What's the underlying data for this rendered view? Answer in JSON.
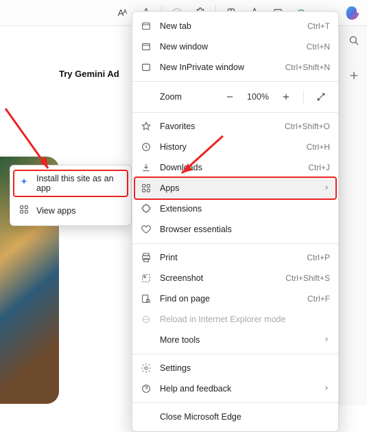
{
  "toolbar": {
    "read_aloud": "Aᴬ",
    "icons": [
      "favorites-star",
      "shield-icon",
      "extensions-icon",
      "collections-icon",
      "favorites-add-icon",
      "clip-icon",
      "performance-icon",
      "more-icon"
    ]
  },
  "page": {
    "gemini_text": "Try Gemini Ad"
  },
  "sidebar_icons": [
    "search-icon",
    "plus-icon"
  ],
  "submenu": {
    "install_label": "Install this site as an app",
    "view_label": "View apps"
  },
  "menu": {
    "new_tab": {
      "label": "New tab",
      "shortcut": "Ctrl+T"
    },
    "new_window": {
      "label": "New window",
      "shortcut": "Ctrl+N"
    },
    "new_inprivate": {
      "label": "New InPrivate window",
      "shortcut": "Ctrl+Shift+N"
    },
    "zoom": {
      "label": "Zoom",
      "value": "100%"
    },
    "favorites": {
      "label": "Favorites",
      "shortcut": "Ctrl+Shift+O"
    },
    "history": {
      "label": "History",
      "shortcut": "Ctrl+H"
    },
    "downloads": {
      "label": "Downloads",
      "shortcut": "Ctrl+J"
    },
    "apps": {
      "label": "Apps"
    },
    "extensions": {
      "label": "Extensions"
    },
    "browser_essentials": {
      "label": "Browser essentials"
    },
    "print": {
      "label": "Print",
      "shortcut": "Ctrl+P"
    },
    "screenshot": {
      "label": "Screenshot",
      "shortcut": "Ctrl+Shift+S"
    },
    "find": {
      "label": "Find on page",
      "shortcut": "Ctrl+F"
    },
    "reload_ie": {
      "label": "Reload in Internet Explorer mode"
    },
    "more_tools": {
      "label": "More tools"
    },
    "settings": {
      "label": "Settings"
    },
    "help": {
      "label": "Help and feedback"
    },
    "close": {
      "label": "Close Microsoft Edge"
    }
  }
}
